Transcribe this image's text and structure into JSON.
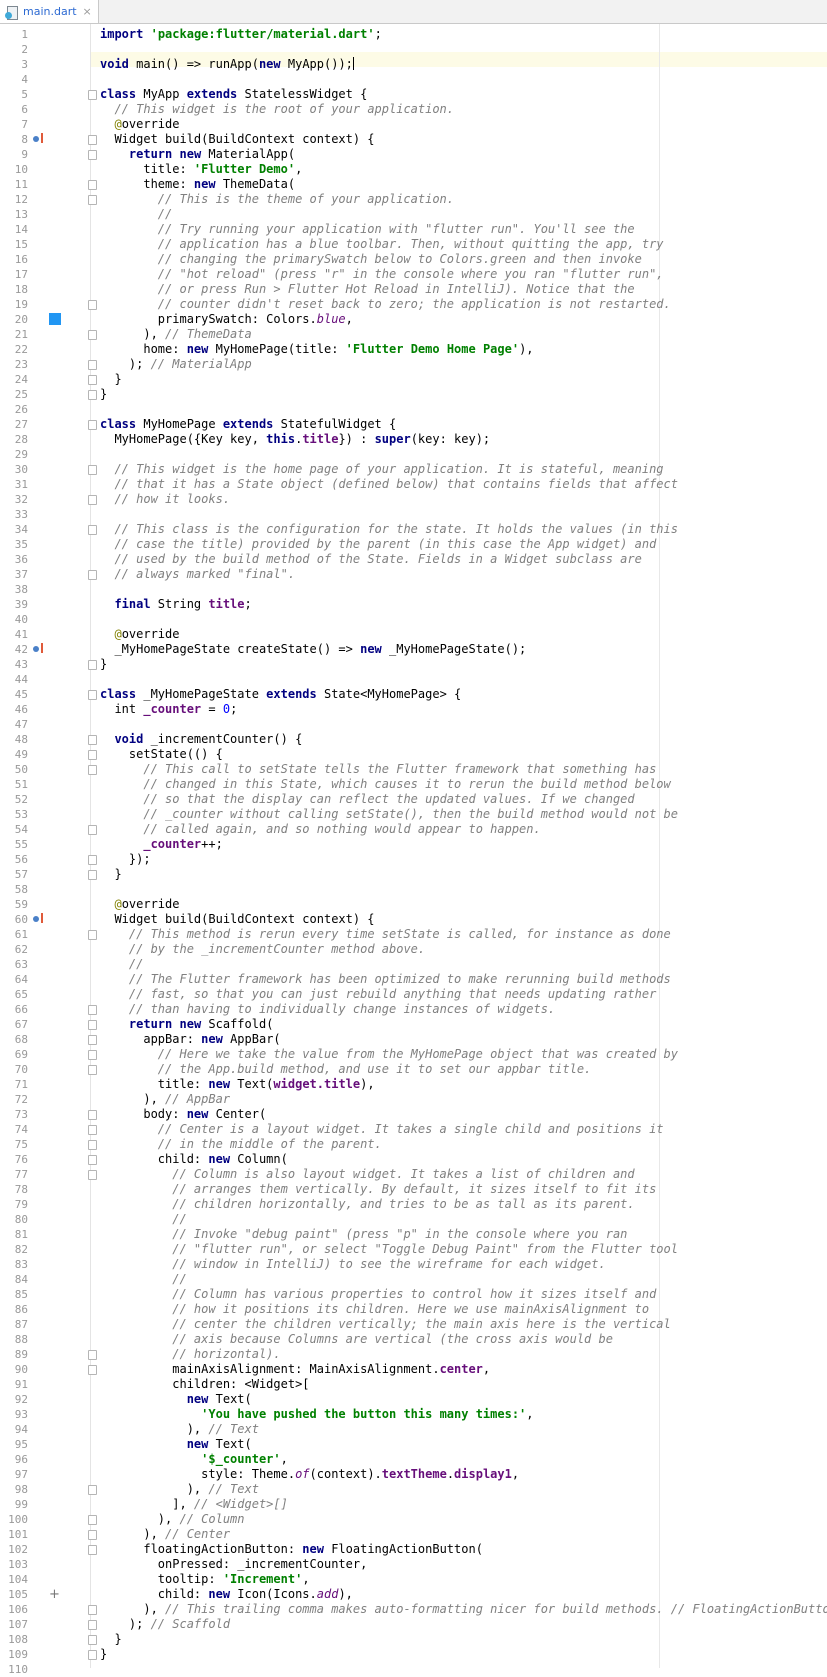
{
  "tab": {
    "filename": "main.dart",
    "close": "×",
    "icon": "dart-file-icon"
  },
  "gutter_icons": {
    "override_lines": [
      8,
      42,
      60
    ],
    "color_swatch_line": 20,
    "color_swatch_color": "#2196f3",
    "add_icon_line": 105
  },
  "editor": {
    "cursor_line": 3,
    "line_numbers": [
      "1",
      "2",
      "3",
      "4",
      "5",
      "6",
      "7",
      "8",
      "9",
      "10",
      "11",
      "12",
      "13",
      "14",
      "15",
      "16",
      "17",
      "18",
      "19",
      "20",
      "21",
      "22",
      "23",
      "24",
      "25",
      "26",
      "27",
      "28",
      "29",
      "30",
      "31",
      "32",
      "33",
      "34",
      "35",
      "36",
      "37",
      "38",
      "39",
      "40",
      "41",
      "42",
      "43",
      "44",
      "45",
      "46",
      "47",
      "48",
      "49",
      "50",
      "51",
      "52",
      "53",
      "54",
      "55",
      "56",
      "57",
      "58",
      "59",
      "60",
      "61",
      "62",
      "63",
      "64",
      "65",
      "66",
      "67",
      "68",
      "69",
      "70",
      "71",
      "72",
      "73",
      "74",
      "75",
      "76",
      "77",
      "78",
      "79",
      "80",
      "81",
      "82",
      "83",
      "84",
      "85",
      "86",
      "87",
      "88",
      "89",
      "90",
      "91",
      "92",
      "93",
      "94",
      "95",
      "96",
      "97",
      "98",
      "99",
      "100",
      "101",
      "102",
      "103",
      "104",
      "105",
      "106",
      "107",
      "108",
      "109",
      "110"
    ],
    "lines": [
      "[[kw:import]] [[str:'package:flutter/material.dart']];",
      "",
      "[[kw:void]] main() => runApp([[kw:new]] MyApp());",
      "",
      "[[kw:class]] MyApp [[kw:extends]] StatelessWidget {",
      "  [[cmt:// This widget is the root of your application.]]",
      "  [[ann:@]]override",
      "  Widget build(BuildContext context) {",
      "    [[kw:return]] [[kw:new]] MaterialApp(",
      "      title: [[str:'Flutter Demo']],",
      "      theme: [[kw:new]] ThemeData(",
      "        [[cmt:// This is the theme of your application.]]",
      "        [[cmt://]]",
      "        [[cmt:// Try running your application with \"flutter run\". You'll see the]]",
      "        [[cmt:// application has a blue toolbar. Then, without quitting the app, try]]",
      "        [[cmt:// changing the primarySwatch below to Colors.green and then invoke]]",
      "        [[cmt:// \"hot reload\" (press \"r\" in the console where you ran \"flutter run\",]]",
      "        [[cmt:// or press Run > Flutter Hot Reload in IntelliJ). Notice that the]]",
      "        [[cmt:// counter didn't reset back to zero; the application is not restarted.]]",
      "        primarySwatch: Colors.[[stat:blue]],",
      "      ), [[cmt:// ThemeData]]",
      "      home: [[kw:new]] MyHomePage(title: [[str:'Flutter Demo Home Page']]),",
      "    ); [[cmt:// MaterialApp]]",
      "  }",
      "}",
      "",
      "[[kw:class]] MyHomePage [[kw:extends]] StatefulWidget {",
      "  MyHomePage({Key key, [[kw:this]].[[field:title]]}) : [[kw:super]](key: key);",
      "",
      "  [[cmt:// This widget is the home page of your application. It is stateful, meaning]]",
      "  [[cmt:// that it has a State object (defined below) that contains fields that affect]]",
      "  [[cmt:// how it looks.]]",
      "",
      "  [[cmt:// This class is the configuration for the state. It holds the values (in this]]",
      "  [[cmt:// case the title) provided by the parent (in this case the App widget) and]]",
      "  [[cmt:// used by the build method of the State. Fields in a Widget subclass are]]",
      "  [[cmt:// always marked \"final\".]]",
      "",
      "  [[kw:final]] String [[field:title]];",
      "",
      "  [[ann:@]]override",
      "  _MyHomePageState createState() => [[kw:new]] _MyHomePageState();",
      "}",
      "",
      "[[kw:class]] _MyHomePageState [[kw:extends]] State<MyHomePage> {",
      "  int [[field:_counter]] = [[num:0]];",
      "",
      "  [[kw:void]] _incrementCounter() {",
      "    setState(() {",
      "      [[cmt:// This call to setState tells the Flutter framework that something has]]",
      "      [[cmt:// changed in this State, which causes it to rerun the build method below]]",
      "      [[cmt:// so that the display can reflect the updated values. If we changed]]",
      "      [[cmt:// _counter without calling setState(), then the build method would not be]]",
      "      [[cmt:// called again, and so nothing would appear to happen.]]",
      "      [[field:_counter]]++;",
      "    });",
      "  }",
      "",
      "  [[ann:@]]override",
      "  Widget build(BuildContext context) {",
      "    [[cmt:// This method is rerun every time setState is called, for instance as done]]",
      "    [[cmt:// by the _incrementCounter method above.]]",
      "    [[cmt://]]",
      "    [[cmt:// The Flutter framework has been optimized to make rerunning build methods]]",
      "    [[cmt:// fast, so that you can just rebuild anything that needs updating rather]]",
      "    [[cmt:// than having to individually change instances of widgets.]]",
      "    [[kw:return]] [[kw:new]] Scaffold(",
      "      appBar: [[kw:new]] AppBar(",
      "        [[cmt:// Here we take the value from the MyHomePage object that was created by]]",
      "        [[cmt:// the App.build method, and use it to set our appbar title.]]",
      "        title: [[kw:new]] Text([[field:widget.title]]),",
      "      ), [[cmt:// AppBar]]",
      "      body: [[kw:new]] Center(",
      "        [[cmt:// Center is a layout widget. It takes a single child and positions it]]",
      "        [[cmt:// in the middle of the parent.]]",
      "        child: [[kw:new]] Column(",
      "          [[cmt:// Column is also layout widget. It takes a list of children and]]",
      "          [[cmt:// arranges them vertically. By default, it sizes itself to fit its]]",
      "          [[cmt:// children horizontally, and tries to be as tall as its parent.]]",
      "          [[cmt://]]",
      "          [[cmt:// Invoke \"debug paint\" (press \"p\" in the console where you ran]]",
      "          [[cmt:// \"flutter run\", or select \"Toggle Debug Paint\" from the Flutter tool]]",
      "          [[cmt:// window in IntelliJ) to see the wireframe for each widget.]]",
      "          [[cmt://]]",
      "          [[cmt:// Column has various properties to control how it sizes itself and]]",
      "          [[cmt:// how it positions its children. Here we use mainAxisAlignment to]]",
      "          [[cmt:// center the children vertically; the main axis here is the vertical]]",
      "          [[cmt:// axis because Columns are vertical (the cross axis would be]]",
      "          [[cmt:// horizontal).]]",
      "          mainAxisAlignment: MainAxisAlignment.[[field:center]],",
      "          children: <Widget>[",
      "            [[kw:new]] Text(",
      "              [[str:'You have pushed the button this many times:']],",
      "            ), [[cmt:// Text]]",
      "            [[kw:new]] Text(",
      "              [[str:'$_counter']],",
      "              style: Theme.[[stat:of]](context).[[field:textTheme]].[[field:display1]],",
      "            ), [[cmt:// Text]]",
      "          ], [[cmt:// <Widget>[]]]",
      "        ), [[cmt:// Column]]",
      "      ), [[cmt:// Center]]",
      "      floatingActionButton: [[kw:new]] FloatingActionButton(",
      "        onPressed: _incrementCounter,",
      "        tooltip: [[str:'Increment']],",
      "        child: [[kw:new]] Icon(Icons.[[stat:add]]),",
      "      ), [[cmt:// This trailing comma makes auto-formatting nicer for build methods. // FloatingActionButton]]",
      "    ); [[cmt:// Scaffold]]",
      "  }",
      "}",
      ""
    ]
  }
}
